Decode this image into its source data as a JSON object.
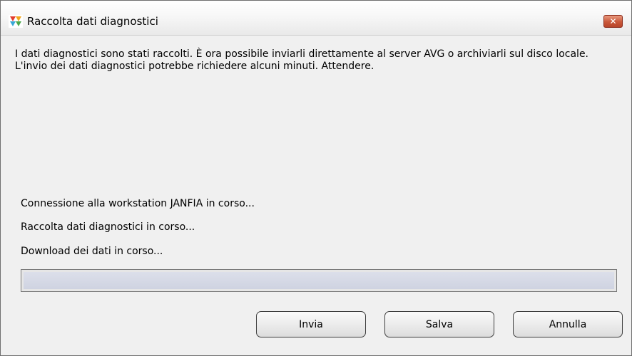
{
  "window": {
    "title": "Raccolta dati diagnostici",
    "close_glyph": "✕",
    "icon": "avg-app-icon"
  },
  "message": "I dati diagnostici sono stati raccolti. È ora possibile inviarli direttamente al server AVG o archiviarli sul disco locale. L'invio dei dati diagnostici potrebbe richiedere alcuni minuti. Attendere.",
  "status": {
    "line1": "Connessione alla workstation JANFIA in corso...",
    "line2": "Raccolta dati diagnostici in corso...",
    "line3": "Download dei dati in corso..."
  },
  "progress": {
    "percent": 0
  },
  "buttons": {
    "send": "Invia",
    "save": "Salva",
    "cancel": "Annulla"
  },
  "colors": {
    "close_button": "#c9573a",
    "progress_track": "#cfd3e1"
  }
}
